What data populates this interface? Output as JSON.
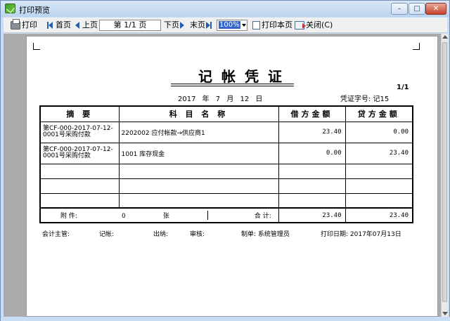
{
  "window": {
    "title": "打印预览",
    "btn_min": "–",
    "btn_max": "□",
    "btn_close": "✕"
  },
  "toolbar": {
    "print": "打印",
    "first": "首页",
    "prev": "上页",
    "page_indicator": "第 1/1 页",
    "next": "下页",
    "last": "末页",
    "zoom": "100%",
    "print_page": "打印本页",
    "close": "关闭(C)"
  },
  "voucher": {
    "title": "记帐凭证",
    "page_no": "1/1",
    "date": "2017 年 7 月 12 日",
    "voucher_no": "凭证字号:  记15",
    "headers": {
      "summary": "摘 要",
      "account": "科 目 名 称",
      "debit": "借方金额",
      "credit": "贷方金额"
    },
    "rows": [
      {
        "summary": "第CF-000-2017-07-12-0001号采购付款",
        "account": "2202002 应付帐款→供应商1",
        "debit": "23.40",
        "credit": "0.00"
      },
      {
        "summary": "第CF-000-2017-07-12-0001号采购付款",
        "account": "1001 库存现金",
        "debit": "0.00",
        "credit": "23.40"
      },
      {
        "summary": "",
        "account": "",
        "debit": "",
        "credit": ""
      },
      {
        "summary": "",
        "account": "",
        "debit": "",
        "credit": ""
      },
      {
        "summary": "",
        "account": "",
        "debit": "",
        "credit": ""
      }
    ],
    "attachments_label": "附      件:",
    "attachments_count": "0",
    "attachments_unit": "张",
    "total_label": "合    计:",
    "total_debit": "23.40",
    "total_credit": "23.40"
  },
  "footer": {
    "supervisor": "会计主管:",
    "bookkeeper": "记帐:",
    "cashier": "出纳:",
    "auditor": "审核:",
    "maker": "制单:  系统管理员",
    "print_date": "打印日期:  2017年07月13日"
  }
}
